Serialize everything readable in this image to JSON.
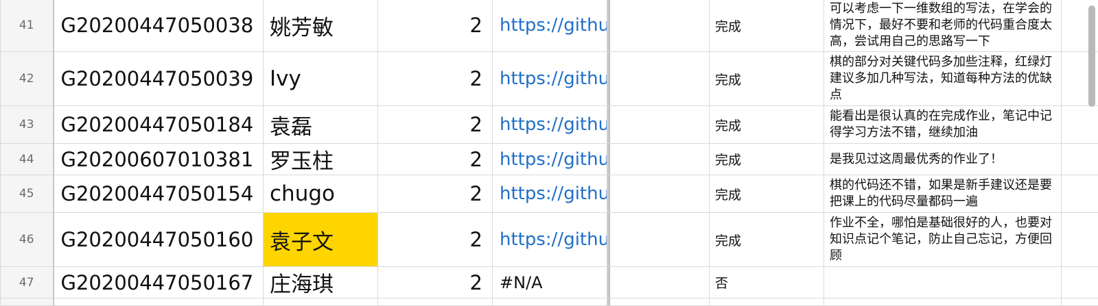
{
  "rows": [
    {
      "n": "41",
      "id": "G20200447050038",
      "name": "姚芳敏",
      "count": "2",
      "link": "https://githul",
      "status": "完成",
      "comment": "可以考虑一下一维数组的写法，在学会的情况下，最好不要和老师的代码重合度太高，尝试用自己的思路写一下",
      "highlight": false,
      "link_na": false
    },
    {
      "n": "42",
      "id": "G20200447050039",
      "name": "Ivy",
      "count": "2",
      "link": "https://githul",
      "status": "完成",
      "comment": "棋的部分对关键代码多加些注释，红绿灯建议多加几种写法，知道每种方法的优缺点",
      "highlight": false,
      "link_na": false
    },
    {
      "n": "43",
      "id": "G20200447050184",
      "name": "袁磊",
      "count": "2",
      "link": "https://githul",
      "status": "完成",
      "comment": "能看出是很认真的在完成作业，笔记中记得学习方法不错，继续加油",
      "highlight": false,
      "link_na": false
    },
    {
      "n": "44",
      "id": "G20200607010381",
      "name": "罗玉柱",
      "count": "2",
      "link": "https://githul",
      "status": "完成",
      "comment": "是我见过这周最优秀的作业了！",
      "highlight": false,
      "link_na": false
    },
    {
      "n": "45",
      "id": "G20200447050154",
      "name": "chugo",
      "count": "2",
      "link": "https://githul",
      "status": "完成",
      "comment": "棋的代码还不错，如果是新手建议还是要把课上的代码尽量都码一遍",
      "highlight": false,
      "link_na": false
    },
    {
      "n": "46",
      "id": "G20200447050160",
      "name": "袁子文",
      "count": "2",
      "link": "https://githul",
      "status": "完成",
      "comment": "作业不全，哪怕是基础很好的人，也要对知识点记个笔记，防止自己忘记，方便回顾",
      "highlight": true,
      "link_na": false
    },
    {
      "n": "47",
      "id": "G20200447050167",
      "name": "庄海琪",
      "count": "2",
      "link": "#N/A",
      "status": "否",
      "comment": "",
      "highlight": false,
      "link_na": true
    }
  ]
}
